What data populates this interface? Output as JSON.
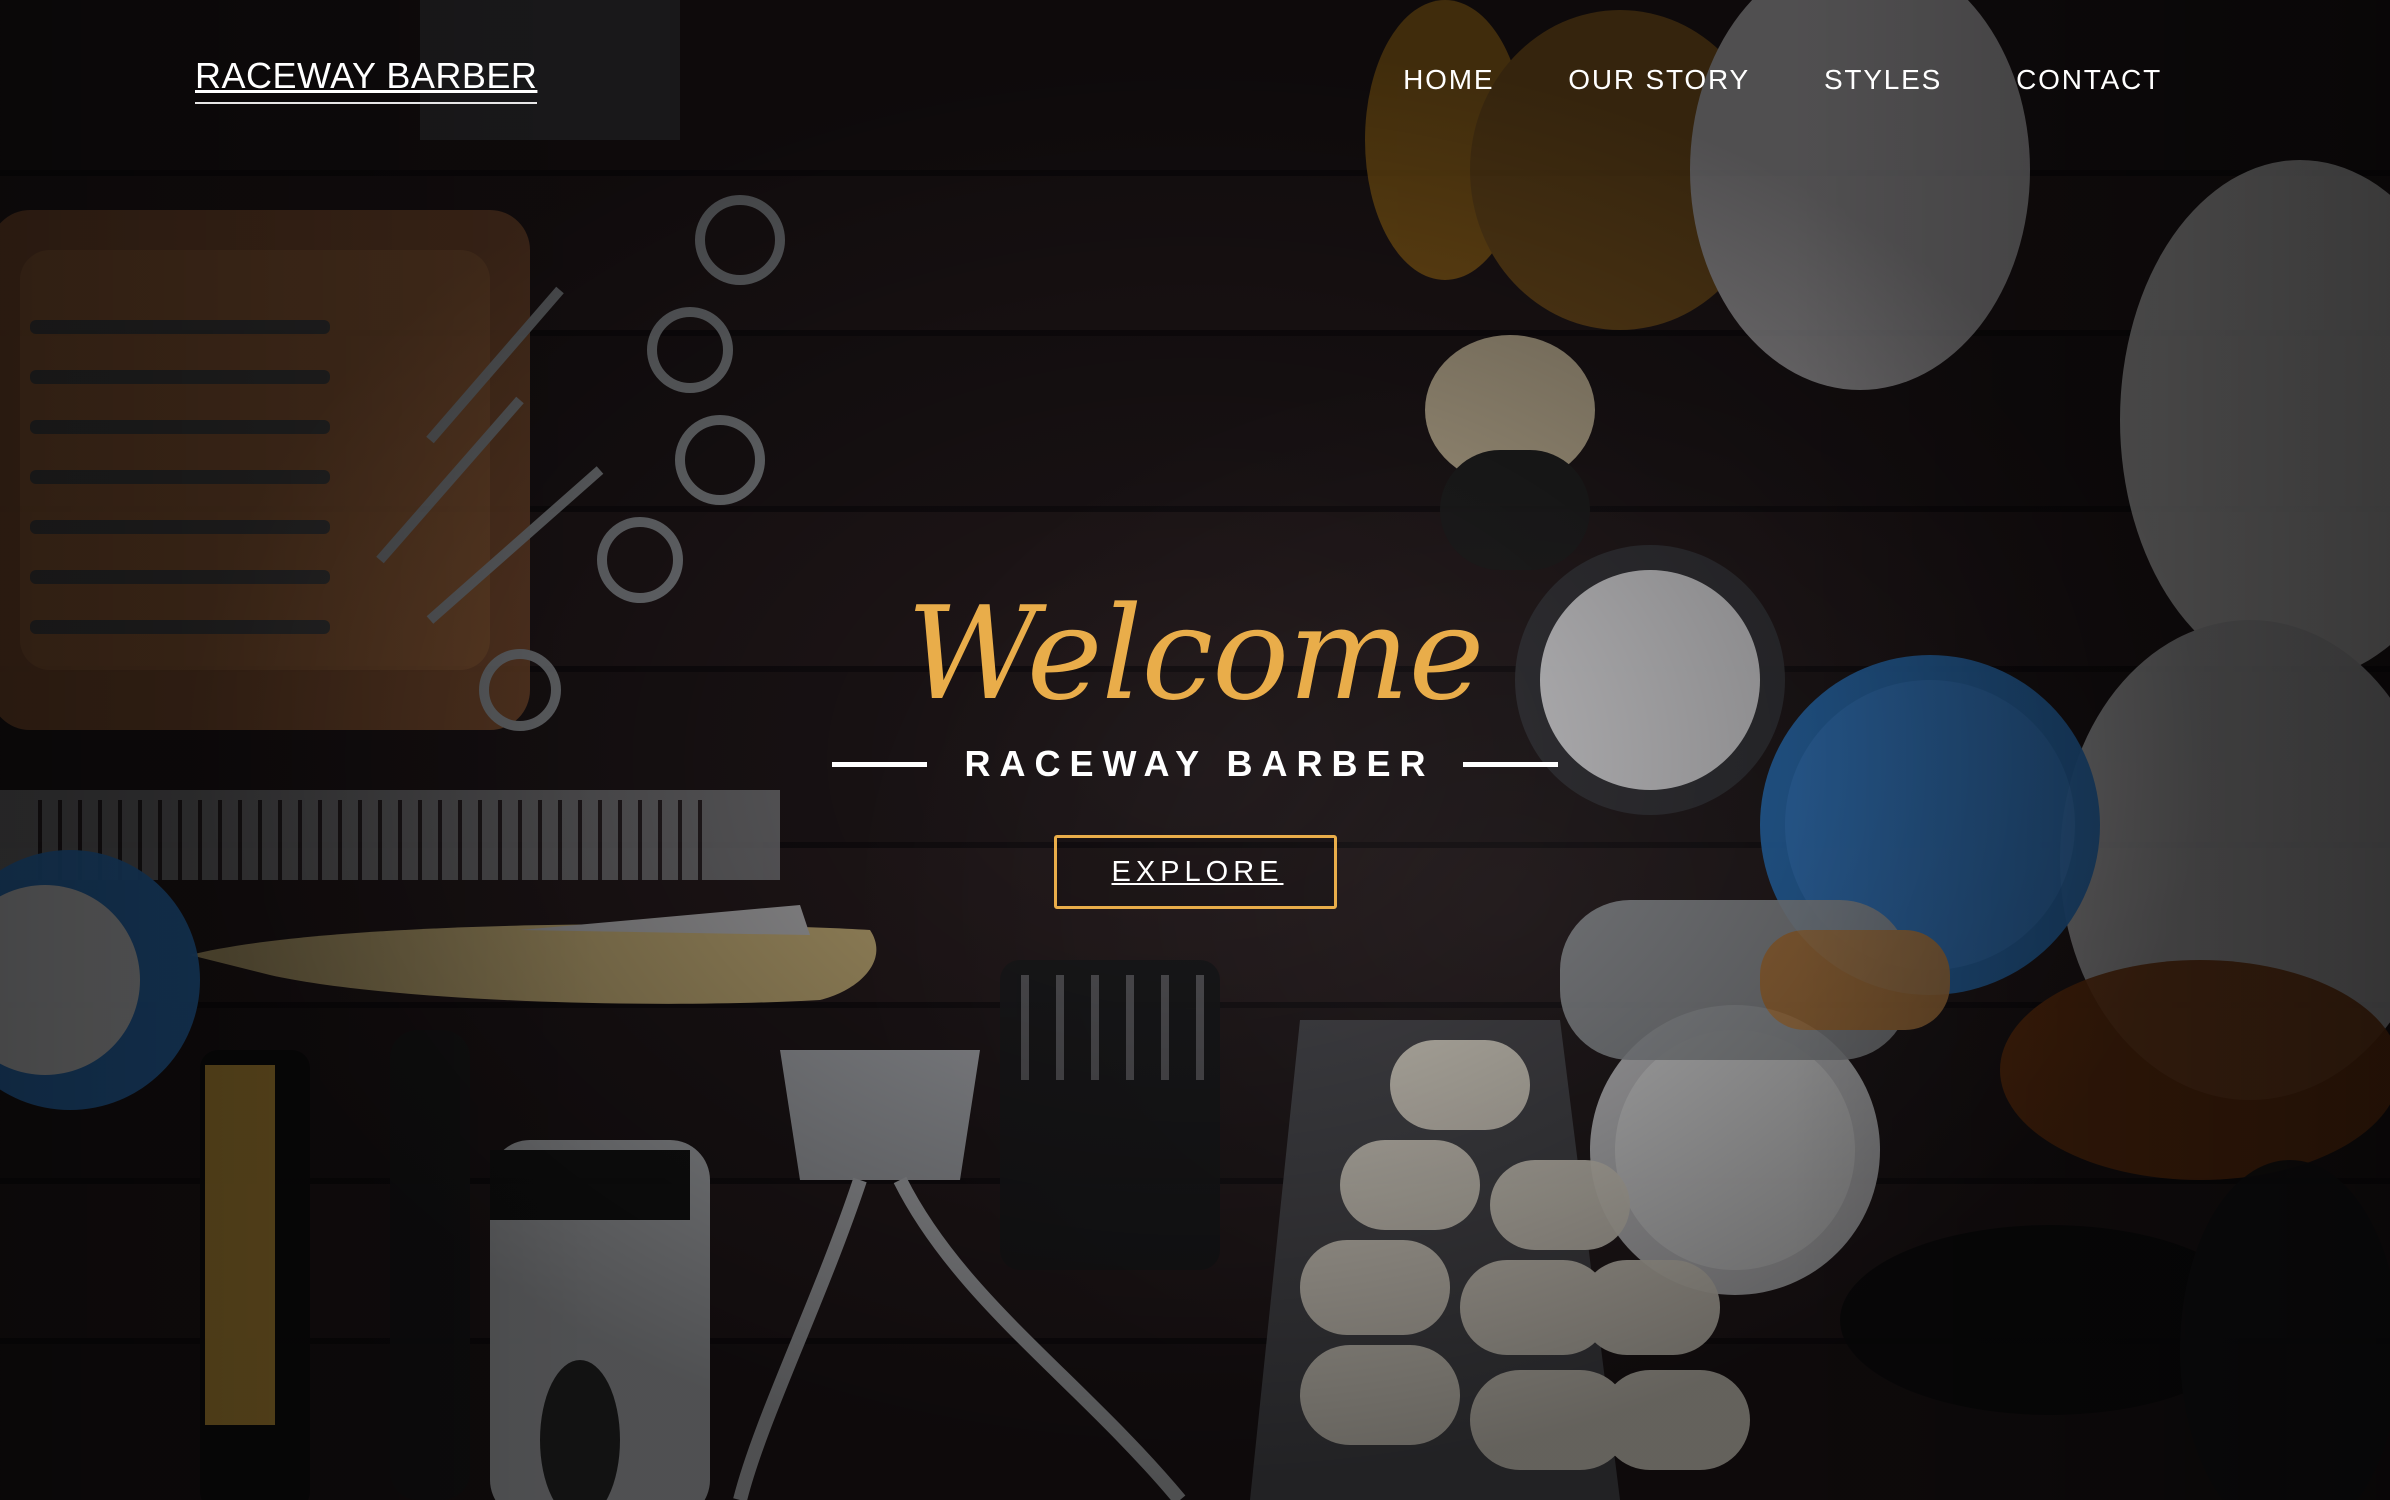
{
  "brand": {
    "name": "RACEWAY BARBER"
  },
  "nav": {
    "items": [
      {
        "label": "HOME"
      },
      {
        "label": "OUR STORY"
      },
      {
        "label": "STYLES"
      },
      {
        "label": "CONTACT"
      }
    ]
  },
  "hero": {
    "welcome": "Welcome",
    "subtitle": "RACEWAY BARBER",
    "button_label": "EXPLORE"
  },
  "colors": {
    "accent": "#e9ad4a",
    "text": "#ffffff",
    "background": "#1f1618"
  },
  "background_image": {
    "description_icon": "barber-tools-photo"
  }
}
